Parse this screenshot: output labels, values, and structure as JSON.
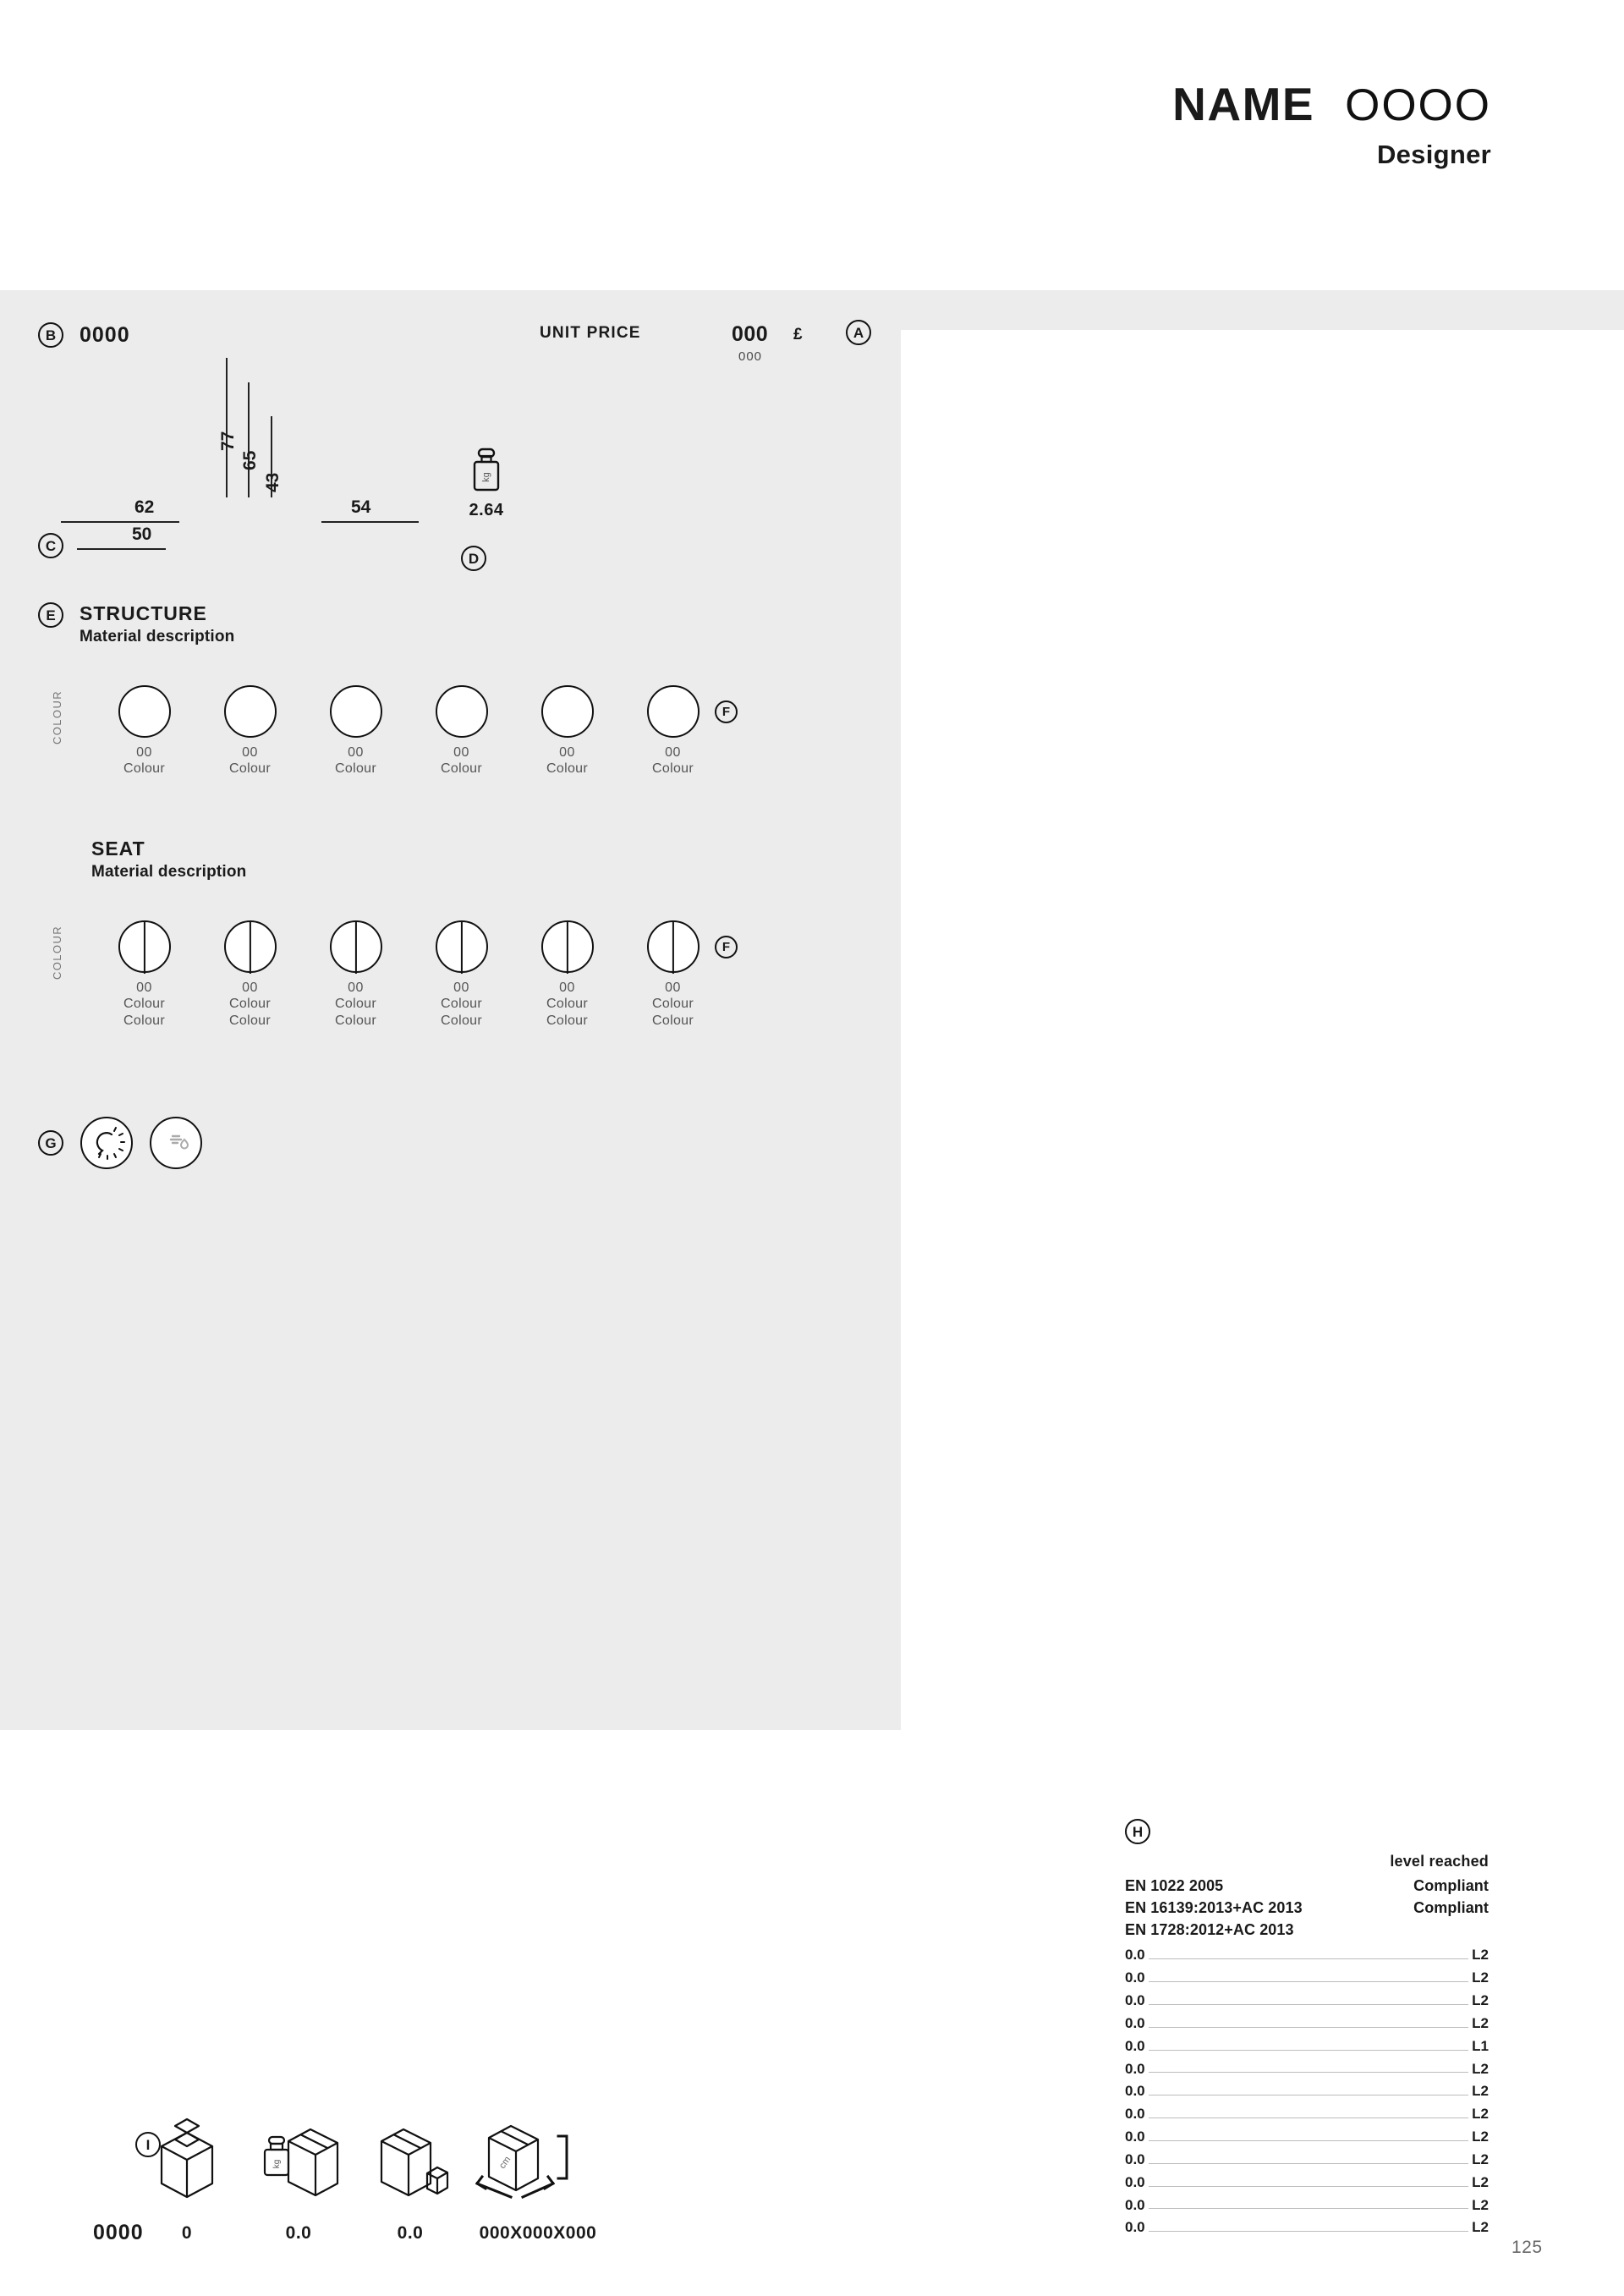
{
  "header": {
    "name": "NAME",
    "code": "OOOO",
    "designer": "Designer"
  },
  "panel": {
    "badge_b": "B",
    "product_code": "0000",
    "unit_price_label": "UNIT PRICE",
    "price": "000",
    "currency": "£",
    "price_sub": "000",
    "badge_a": "A"
  },
  "dimensions": {
    "badge_c": "C",
    "badge_d": "D",
    "vertical": [
      "77",
      "65",
      "43"
    ],
    "horizontal_left": [
      "62",
      "50"
    ],
    "horizontal_right": "54",
    "weight_unit": "kg",
    "weight_value": "2.64"
  },
  "structure": {
    "badge_e": "E",
    "title": "STRUCTURE",
    "subtitle": "Material description",
    "axis_label": "COLOUR",
    "badge_f": "F",
    "swatches": [
      {
        "code": "00",
        "name": "Colour"
      },
      {
        "code": "00",
        "name": "Colour"
      },
      {
        "code": "00",
        "name": "Colour"
      },
      {
        "code": "00",
        "name": "Colour"
      },
      {
        "code": "00",
        "name": "Colour"
      },
      {
        "code": "00",
        "name": "Colour"
      }
    ]
  },
  "seat": {
    "title": "SEAT",
    "subtitle": "Material description",
    "axis_label": "COLOUR",
    "badge_f": "F",
    "swatches": [
      {
        "code": "00",
        "name1": "Colour",
        "name2": "Colour"
      },
      {
        "code": "00",
        "name1": "Colour",
        "name2": "Colour"
      },
      {
        "code": "00",
        "name1": "Colour",
        "name2": "Colour"
      },
      {
        "code": "00",
        "name1": "Colour",
        "name2": "Colour"
      },
      {
        "code": "00",
        "name1": "Colour",
        "name2": "Colour"
      },
      {
        "code": "00",
        "name1": "Colour",
        "name2": "Colour"
      }
    ]
  },
  "features": {
    "badge_g": "G",
    "icons": [
      "sun-icon",
      "water-drop-icon"
    ]
  },
  "certifications": {
    "badge_h": "H",
    "column_header": "level reached",
    "standards": [
      {
        "name": "EN 1022 2005",
        "result": "Compliant"
      },
      {
        "name": "EN 16139:2013+AC 2013",
        "result": "Compliant"
      },
      {
        "name": "EN 1728:2012+AC 2013",
        "result": ""
      }
    ],
    "tests": [
      {
        "value": "0.0",
        "level": "L2"
      },
      {
        "value": "0.0",
        "level": "L2"
      },
      {
        "value": "0.0",
        "level": "L2"
      },
      {
        "value": "0.0",
        "level": "L2"
      },
      {
        "value": "0.0",
        "level": "L1"
      },
      {
        "value": "0.0",
        "level": "L2"
      },
      {
        "value": "0.0",
        "level": "L2"
      },
      {
        "value": "0.0",
        "level": "L2"
      },
      {
        "value": "0.0",
        "level": "L2"
      },
      {
        "value": "0.0",
        "level": "L2"
      },
      {
        "value": "0.0",
        "level": "L2"
      },
      {
        "value": "0.0",
        "level": "L2"
      },
      {
        "value": "0.0",
        "level": "L2"
      }
    ]
  },
  "packaging": {
    "badge_i": "I",
    "code": "0000",
    "items": [
      {
        "icon": "open-box-icon",
        "value": "0"
      },
      {
        "icon": "box-weight-icon",
        "value": "0.0"
      },
      {
        "icon": "box-volume-icon",
        "value": "0.0"
      },
      {
        "icon": "box-dimensions-icon",
        "value": "000X000X000"
      }
    ]
  },
  "footer": {
    "page_number": "125"
  }
}
